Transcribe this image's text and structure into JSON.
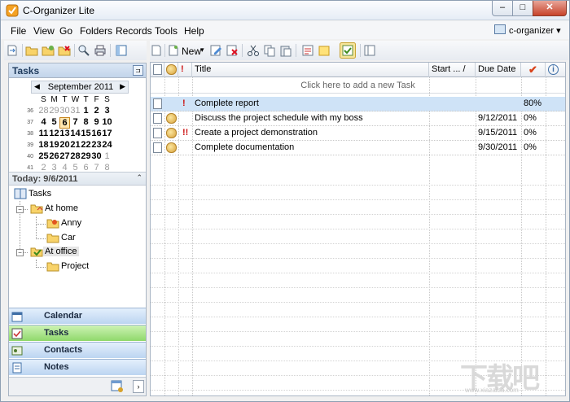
{
  "window": {
    "title": "C-Organizer Lite",
    "min": "–",
    "max": "□",
    "close": "✕"
  },
  "menu": [
    {
      "label": "File"
    },
    {
      "label": "View"
    },
    {
      "label": "Go"
    },
    {
      "label": "Folders"
    },
    {
      "label": "Records"
    },
    {
      "label": "Tools"
    },
    {
      "label": "Help"
    }
  ],
  "profile": {
    "name": "c-organizer",
    "arrow": "▾"
  },
  "toolbar": {
    "new_label": "New",
    "new_arrow": "▾"
  },
  "pane": {
    "title": "Tasks",
    "pin": "⊐"
  },
  "calendar": {
    "month": "September 2011",
    "prev": "◀",
    "next": "▶",
    "dow": [
      "S",
      "M",
      "T",
      "W",
      "T",
      "F",
      "S"
    ],
    "weeks": [
      {
        "wk": "36",
        "days": [
          "28",
          "29",
          "30",
          "31",
          "1",
          "2",
          "3"
        ],
        "dim": [
          1,
          1,
          1,
          1,
          0,
          0,
          0
        ]
      },
      {
        "wk": "37",
        "days": [
          "4",
          "5",
          "6",
          "7",
          "8",
          "9",
          "10"
        ],
        "dim": [
          0,
          0,
          0,
          0,
          0,
          0,
          0
        ]
      },
      {
        "wk": "38",
        "days": [
          "11",
          "12",
          "13",
          "14",
          "15",
          "16",
          "17"
        ],
        "dim": [
          0,
          0,
          0,
          0,
          0,
          0,
          0
        ]
      },
      {
        "wk": "39",
        "days": [
          "18",
          "19",
          "20",
          "21",
          "22",
          "23",
          "24"
        ],
        "dim": [
          0,
          0,
          0,
          0,
          0,
          0,
          0
        ]
      },
      {
        "wk": "40",
        "days": [
          "25",
          "26",
          "27",
          "28",
          "29",
          "30",
          "1"
        ],
        "dim": [
          0,
          0,
          0,
          0,
          0,
          0,
          1
        ]
      },
      {
        "wk": "41",
        "days": [
          "2",
          "3",
          "4",
          "5",
          "6",
          "7",
          "8"
        ],
        "dim": [
          1,
          1,
          1,
          1,
          1,
          1,
          1
        ]
      }
    ],
    "today_day": "6"
  },
  "today": {
    "label": "Today: 9/6/2011",
    "chevron": "⌃"
  },
  "tree": {
    "root": "Tasks",
    "at_home": "At home",
    "anny": "Anny",
    "car": "Car",
    "at_office": "At office",
    "project": "Project",
    "minus": "−"
  },
  "nav": [
    {
      "label": "Calendar"
    },
    {
      "label": "Tasks"
    },
    {
      "label": "Contacts"
    },
    {
      "label": "Notes"
    }
  ],
  "nav_footer": {
    "expand": "›"
  },
  "grid": {
    "headers": {
      "title": "Title",
      "start": "Start ...",
      "start_sort": "/",
      "due": "Due Date",
      "done": "✔",
      "info": "i",
      "priority": "!"
    },
    "add_hint": "Click here to add a new Task",
    "rows": [
      {
        "priority": "!",
        "title": "Complete report",
        "start": "",
        "due": "",
        "pct": "80%"
      },
      {
        "priority": "",
        "title": "Discuss the project schedule with my boss",
        "start": "",
        "due": "9/12/2011",
        "pct": "0%"
      },
      {
        "priority": "!!",
        "title": "Create a project demonstration",
        "start": "",
        "due": "9/15/2011",
        "pct": "0%"
      },
      {
        "priority": "",
        "title": "Complete documentation",
        "start": "",
        "due": "9/30/2011",
        "pct": "0%"
      }
    ]
  },
  "watermark": {
    "text": "下载吧",
    "sub": "www.xiazaiba.com"
  },
  "colors": {
    "accent": "#c7432b",
    "selection": "#cfe3f7",
    "nav_active": "#8fd86b",
    "today": "#ffe7b0"
  }
}
